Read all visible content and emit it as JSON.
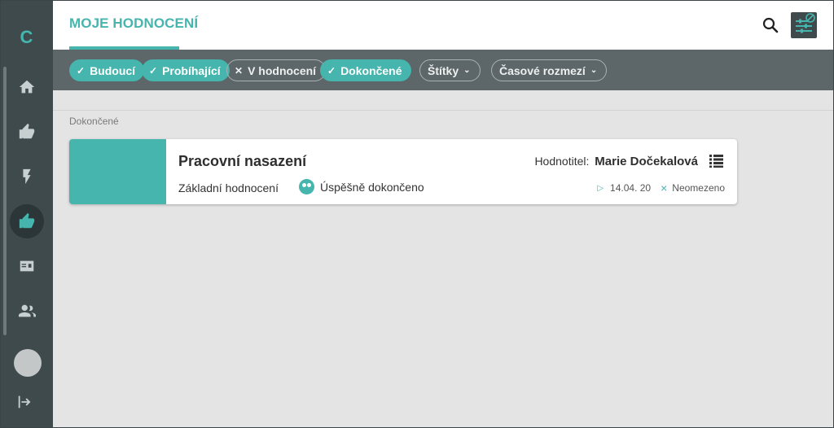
{
  "sidebar": {
    "logo": "C",
    "items": [
      {
        "icon": "home-icon"
      },
      {
        "icon": "thumb-up-icon"
      },
      {
        "icon": "lightning-icon"
      },
      {
        "icon": "thumb-up-icon",
        "active": true
      },
      {
        "icon": "id-card-icon"
      },
      {
        "icon": "people-icon"
      }
    ],
    "exit_icon": "exit-icon"
  },
  "header": {
    "title": "MOJE HODNOCENÍ"
  },
  "filters": [
    {
      "label": "Budoucí",
      "state": "on",
      "mark": "✓"
    },
    {
      "label": "Probíhající",
      "state": "on",
      "mark": "✓"
    },
    {
      "label": "V hodnocení",
      "state": "off",
      "mark": "✕"
    },
    {
      "label": "Dokončené",
      "state": "on",
      "mark": "✓"
    }
  ],
  "dropdowns": [
    {
      "label": "Štítky"
    },
    {
      "label": "Časové rozmezí"
    }
  ],
  "section": {
    "label": "Dokončené"
  },
  "card": {
    "title": "Pracovní nasazení",
    "type": "Základní hodnocení",
    "status": "Úspěšně dokončeno",
    "evaluator_label": "Hodnotitel:",
    "evaluator_name": "Marie Dočekalová",
    "start_date": "14.04. 20",
    "end_label": "Neomezeno"
  },
  "colors": {
    "accent": "#45b5ad",
    "sidebar": "#3e4a4c",
    "filterbar": "#5d6668"
  }
}
